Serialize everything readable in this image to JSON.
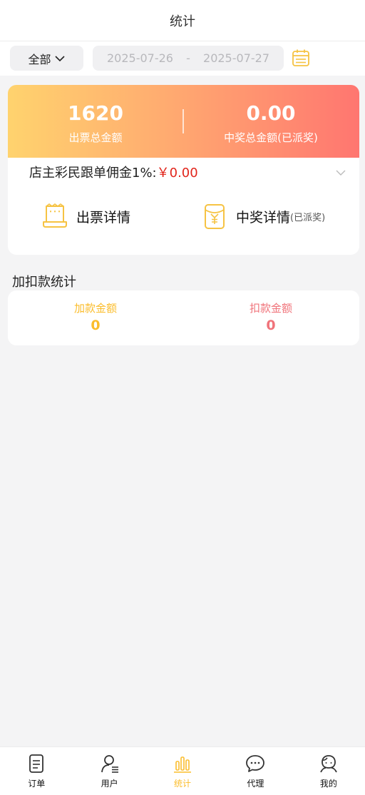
{
  "header": {
    "title": "统计"
  },
  "filter": {
    "scope": "全部",
    "start_date": "2025-07-26",
    "separator": "-",
    "end_date": "2025-07-27"
  },
  "summary": {
    "ticket_total_value": "1620",
    "ticket_total_label": "出票总金额",
    "prize_total_value": "0.00",
    "prize_total_label": "中奖总金额(已派奖)"
  },
  "commission": {
    "label": "店主彩民跟单佣金1%:",
    "amount": "￥0.00"
  },
  "links": {
    "ticket_detail": "出票详情",
    "prize_detail": "中奖详情",
    "prize_detail_note": "(已派奖)"
  },
  "adjustments": {
    "section_title": "加扣款统计",
    "add_label": "加款金额",
    "add_value": "0",
    "deduct_label": "扣款金额",
    "deduct_value": "0"
  },
  "tabs": [
    {
      "label": "订单",
      "icon": "order-icon"
    },
    {
      "label": "用户",
      "icon": "user-icon"
    },
    {
      "label": "统计",
      "icon": "stats-icon",
      "active": true
    },
    {
      "label": "代理",
      "icon": "agent-chat-icon"
    },
    {
      "label": "我的",
      "icon": "profile-icon"
    }
  ],
  "colors": {
    "accent": "#fbbd2c",
    "deduct": "#f0737a",
    "commission_amount": "#e1251b",
    "gradient_start": "#ffd36e",
    "gradient_end": "#ff7670"
  }
}
